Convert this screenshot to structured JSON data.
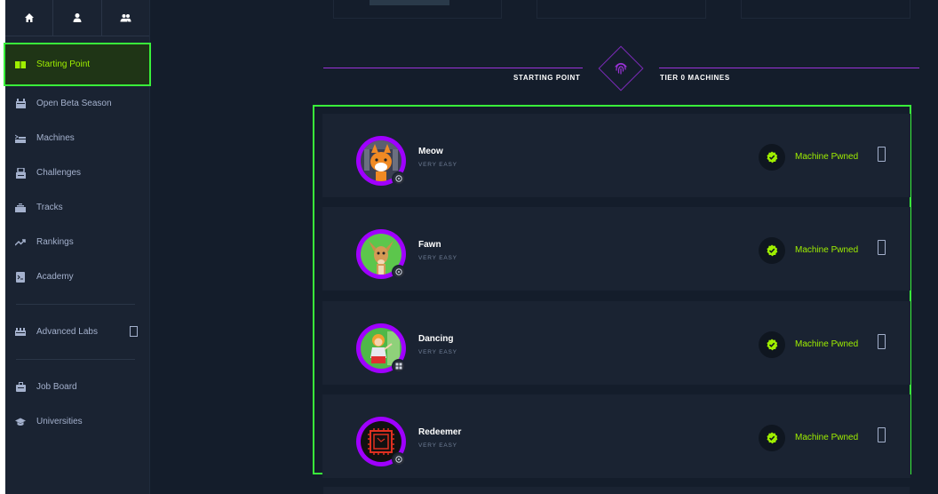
{
  "sidebar": {
    "top_icons": [
      "home-icon",
      "user-icon",
      "team-icon"
    ],
    "items": [
      {
        "label": "Starting Point",
        "icon": "book-icon",
        "active": true
      },
      {
        "label": "Open Beta Season",
        "icon": "season-icon"
      },
      {
        "label": "Machines",
        "icon": "machines-icon"
      },
      {
        "label": "Challenges",
        "icon": "challenges-icon"
      },
      {
        "label": "Tracks",
        "icon": "tracks-icon"
      },
      {
        "label": "Rankings",
        "icon": "rankings-icon"
      },
      {
        "label": "Academy",
        "icon": "academy-icon"
      }
    ],
    "advanced_labs": {
      "label": "Advanced Labs",
      "icon": "labs-icon"
    },
    "bottom_items": [
      {
        "label": "Job Board",
        "icon": "briefcase-icon"
      },
      {
        "label": "Universities",
        "icon": "graduation-icon"
      }
    ]
  },
  "section": {
    "left_label": "STARTING POINT",
    "right_label": "TIER 0 MACHINES",
    "icon": "fingerprint-icon",
    "accent_color": "#9b32d9"
  },
  "machines": [
    {
      "name": "Meow",
      "difficulty": "VERY EASY",
      "status": "Machine Pwned",
      "os": "linux"
    },
    {
      "name": "Fawn",
      "difficulty": "VERY EASY",
      "status": "Machine Pwned",
      "os": "linux"
    },
    {
      "name": "Dancing",
      "difficulty": "VERY EASY",
      "status": "Machine Pwned",
      "os": "windows"
    },
    {
      "name": "Redeemer",
      "difficulty": "VERY EASY",
      "status": "Machine Pwned",
      "os": "linux"
    }
  ],
  "colors": {
    "highlight": "#39f03a",
    "pwned": "#9fef00",
    "avatar_ring": "#9f00ff"
  }
}
